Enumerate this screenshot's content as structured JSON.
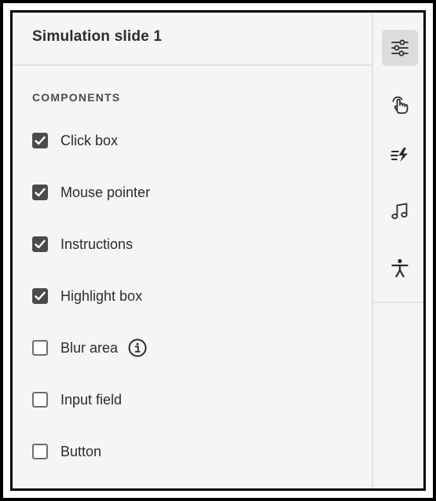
{
  "panel": {
    "title": "Simulation slide 1"
  },
  "components": {
    "section_label": "COMPONENTS",
    "items": [
      {
        "label": "Click box",
        "checked": true
      },
      {
        "label": "Mouse pointer",
        "checked": true
      },
      {
        "label": "Instructions",
        "checked": true
      },
      {
        "label": "Highlight box",
        "checked": true
      },
      {
        "label": "Blur area",
        "checked": false,
        "has_info": true
      },
      {
        "label": "Input field",
        "checked": false
      },
      {
        "label": "Button",
        "checked": false
      }
    ]
  },
  "rail": {
    "items": [
      {
        "icon": "sliders-icon",
        "active": true
      },
      {
        "icon": "touch-hand-icon",
        "active": false
      },
      {
        "icon": "transition-effect-icon",
        "active": false
      },
      {
        "icon": "music-note-icon",
        "active": false
      },
      {
        "icon": "accessibility-icon",
        "active": false
      }
    ]
  },
  "colors": {
    "panel_bg": "#f5f5f5",
    "checkbox_checked": "#4b4b4b",
    "text": "#2c2c2c",
    "active_tab_bg": "#dcdcdc"
  }
}
